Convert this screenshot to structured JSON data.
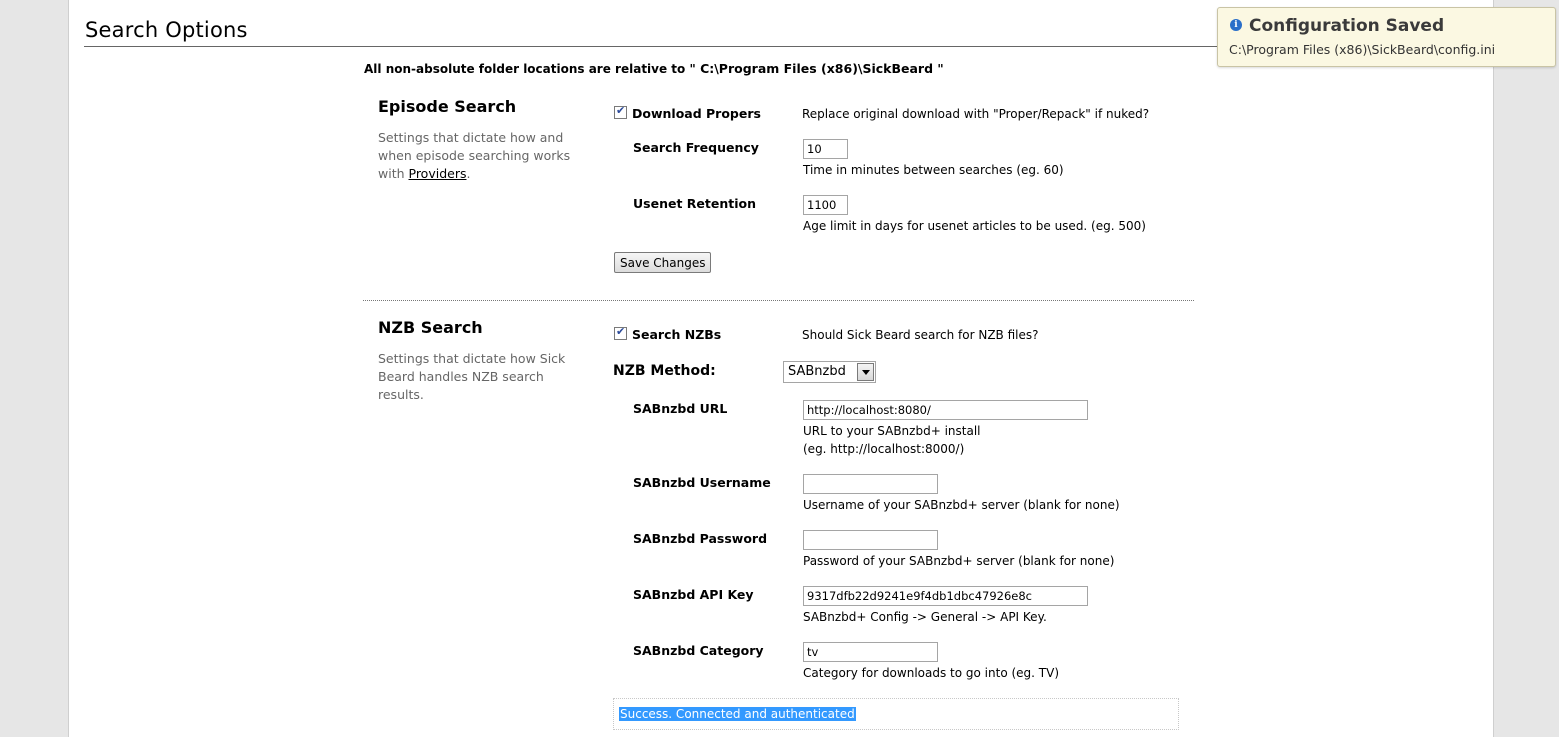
{
  "page": {
    "title": "Search Options",
    "root_note_prefix": "All non-absolute folder locations are relative to \"",
    "root_path": " C:\\Program Files (x86)\\SickBeard ",
    "root_note_suffix": "\""
  },
  "episode_search": {
    "title": "Episode Search",
    "desc_before_link": "Settings that dictate how and when episode searching works with ",
    "desc_link": "Providers",
    "desc_after_link": ".",
    "download_propers": {
      "label": "Download Propers",
      "checked": true,
      "help": "Replace original download with \"Proper/Repack\" if nuked?"
    },
    "search_frequency": {
      "label": "Search Frequency",
      "value": "10",
      "help": "Time in minutes between searches (eg. 60)"
    },
    "usenet_retention": {
      "label": "Usenet Retention",
      "value": "1100",
      "help": "Age limit in days for usenet articles to be used. (eg. 500)"
    },
    "save_label": "Save Changes"
  },
  "nzb_search": {
    "title": "NZB Search",
    "desc": "Settings that dictate how Sick Beard handles NZB search results.",
    "search_nzbs": {
      "label": "Search NZBs",
      "checked": true,
      "help": "Should Sick Beard search for NZB files?"
    },
    "method": {
      "label": "NZB Method:",
      "selected": "SABnzbd"
    },
    "sab_url": {
      "label": "SABnzbd URL",
      "value": "http://localhost:8080/",
      "help_line1": "URL to your SABnzbd+ install",
      "help_line2": "(eg. http://localhost:8000/)"
    },
    "sab_username": {
      "label": "SABnzbd Username",
      "value": "",
      "help": "Username of your SABnzbd+ server (blank for none)"
    },
    "sab_password": {
      "label": "SABnzbd Password",
      "value": "",
      "help": "Password of your SABnzbd+ server (blank for none)"
    },
    "sab_apikey": {
      "label": "SABnzbd API Key",
      "value": "9317dfb22d9241e9f4db1dbc47926e8c",
      "help": "SABnzbd+ Config -> General -> API Key."
    },
    "sab_category": {
      "label": "SABnzbd Category",
      "value": "tv",
      "help": "Category for downloads to go into (eg. TV)"
    },
    "test_result": "Success. Connected and authenticated"
  },
  "toast": {
    "icon": "info-icon",
    "title": "Configuration Saved",
    "body": "C:\\Program Files (x86)\\SickBeard\\config.ini"
  },
  "colors": {
    "background": "#e6e6e6",
    "content": "#ffffff",
    "toast_bg": "#fbf8e2",
    "selection": "#3399ff",
    "description_text": "#666666"
  }
}
